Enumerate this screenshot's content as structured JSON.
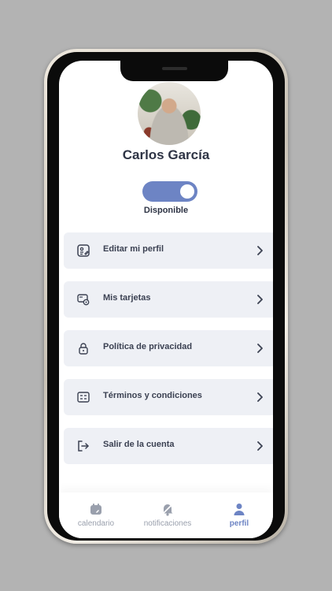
{
  "profile": {
    "name": "Carlos García",
    "status_label": "Disponible",
    "available": true
  },
  "menu": {
    "items": [
      {
        "label": "Editar mi perfil",
        "icon": "id-card-edit-icon"
      },
      {
        "label": "Mis tarjetas",
        "icon": "cards-icon"
      },
      {
        "label": "Política de privacidad",
        "icon": "lock-icon"
      },
      {
        "label": "Términos y condiciones",
        "icon": "document-list-icon"
      },
      {
        "label": "Salir de la cuenta",
        "icon": "logout-icon"
      }
    ]
  },
  "tabbar": {
    "tabs": [
      {
        "label": "calendario",
        "icon": "calendar-icon",
        "active": false
      },
      {
        "label": "notificaciones",
        "icon": "bell-icon",
        "active": false
      },
      {
        "label": "perfil",
        "icon": "user-icon",
        "active": true
      }
    ]
  },
  "colors": {
    "accent": "#6d84c4",
    "text_dark": "#2e3445",
    "menu_bg": "#eef0f5",
    "tab_inactive": "#9aa0ad"
  }
}
